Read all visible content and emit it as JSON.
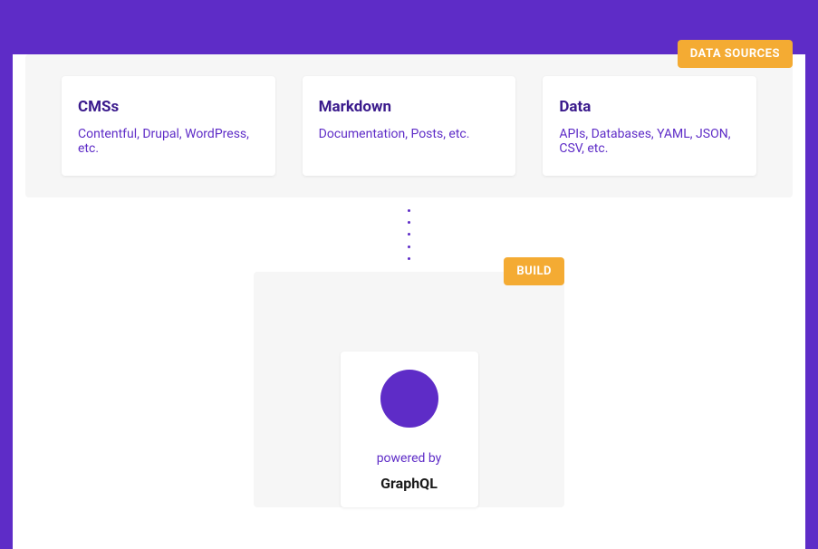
{
  "sections": {
    "dataSources": {
      "label": "DATA SOURCES",
      "cards": [
        {
          "title": "CMSs",
          "subtitle": "Contentful, Drupal, WordPress, etc."
        },
        {
          "title": "Markdown",
          "subtitle": "Documentation, Posts, etc."
        },
        {
          "title": "Data",
          "subtitle": "APIs, Databases, YAML, JSON, CSV, etc."
        }
      ]
    },
    "build": {
      "label": "BUILD",
      "card": {
        "powered": "powered by",
        "name": "GraphQL"
      }
    }
  }
}
